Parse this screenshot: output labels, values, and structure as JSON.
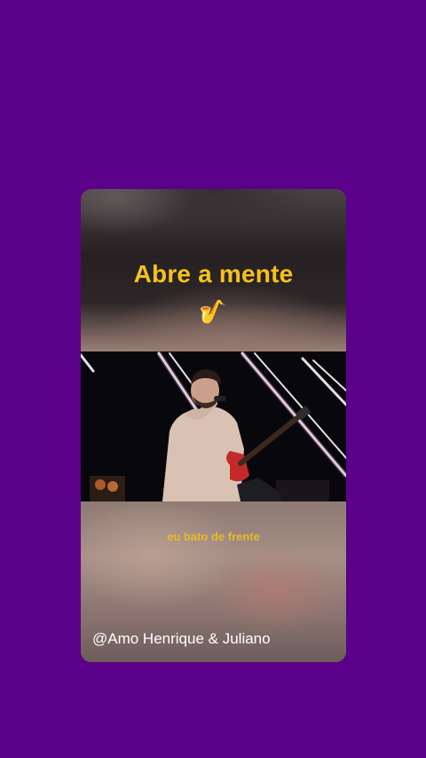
{
  "card": {
    "title": "Abre a mente",
    "emoji": "🎷",
    "lyric": "eu bato de frente",
    "credit": "@Amo Henrique & Juliano"
  },
  "colors": {
    "background": "#5a0089",
    "title_color": "#f5c21b",
    "lyric_color": "#e5ba2a",
    "credit_color": "#ffffff"
  }
}
